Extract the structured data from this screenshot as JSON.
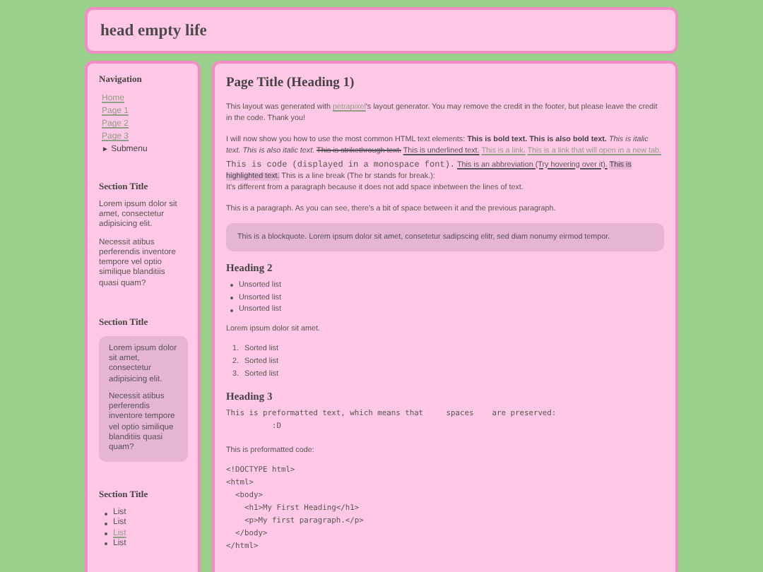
{
  "header": {
    "title": "head empty life"
  },
  "sidebar": {
    "navigation": {
      "title": "Navigation",
      "items": [
        {
          "label": "Home",
          "kind": "link"
        },
        {
          "label": "Page 1",
          "kind": "link"
        },
        {
          "label": "Page 2",
          "kind": "link"
        },
        {
          "label": "Page 3",
          "kind": "link"
        },
        {
          "label": "Submenu",
          "kind": "submenu",
          "expanded": false,
          "marker": "►"
        }
      ]
    },
    "sections": [
      {
        "title": "Section Title",
        "kind": "text",
        "paragraphs": [
          "Lorem ipsum dolor sit amet, consectetur adipisicing elit.",
          "Necessit atibus perferendis inventore tempore vel optio similique blanditiis quasi quam?"
        ]
      },
      {
        "title": "Section Title",
        "kind": "box",
        "paragraphs": [
          "Lorem ipsum dolor sit amet, consectetur adipisicing elit.",
          "Necessit atibus perferendis inventore tempore vel optio similique blanditiis quasi quam?"
        ]
      },
      {
        "title": "Section Title",
        "kind": "list",
        "items": [
          {
            "label": "List",
            "kind": "text"
          },
          {
            "label": "List",
            "kind": "text"
          },
          {
            "label": "List",
            "kind": "link"
          },
          {
            "label": "List",
            "kind": "text"
          }
        ]
      }
    ]
  },
  "main": {
    "blocks": [
      {
        "kind": "h1",
        "text": "Page Title (Heading 1)"
      },
      {
        "kind": "p",
        "segments": [
          {
            "kind": "text",
            "text": "This layout was generated with "
          },
          {
            "kind": "link",
            "text": "petrapixel"
          },
          {
            "kind": "text",
            "text": "'s layout generator. You may remove the credit in the footer, but please leave the credit in the code. Thank you!"
          }
        ]
      },
      {
        "kind": "p",
        "segments": [
          {
            "kind": "text",
            "text": "I will now show you how to use the most common HTML text elements: "
          },
          {
            "kind": "bold",
            "text": "This is bold text."
          },
          {
            "kind": "bold",
            "text": "This is also bold text."
          },
          {
            "kind": "italic",
            "text": "This is italic text."
          },
          {
            "kind": "italic",
            "text": "This is also italic text."
          },
          {
            "kind": "strike",
            "text": "This is strikethrough text."
          },
          {
            "kind": "underline",
            "text": "This is underlined text."
          },
          {
            "kind": "link",
            "text": "This is a link."
          },
          {
            "kind": "link",
            "text": "This is a link that will open in a new tab."
          },
          {
            "kind": "code",
            "text": "This is code (displayed in a monospace font)."
          },
          {
            "kind": "abbr",
            "text": "This is an abbreviation (Try hovering over it)."
          },
          {
            "kind": "highlight",
            "text": "This is highlighted text."
          },
          {
            "kind": "text",
            "text": " This is a line break (The br stands for break.):"
          },
          {
            "kind": "break"
          },
          {
            "kind": "text",
            "text": "It's different from a paragraph because it does not add space inbetween the lines of text."
          }
        ]
      },
      {
        "kind": "p",
        "segments": [
          {
            "kind": "text",
            "text": "This is a paragraph. As you can see, there's a bit of space between it and the previous paragraph."
          }
        ]
      },
      {
        "kind": "blockquote",
        "text": "This is a blockquote. Lorem ipsum dolor sit amet, consetetur sadipscing elitr, sed diam nonumy eirmod tempor."
      },
      {
        "kind": "h2",
        "text": "Heading 2"
      },
      {
        "kind": "ul",
        "items": [
          "Unsorted list",
          "Unsorted list",
          "Unsorted list"
        ]
      },
      {
        "kind": "p",
        "segments": [
          {
            "kind": "text",
            "text": "Lorem ipsum dolor sit amet."
          }
        ]
      },
      {
        "kind": "ol",
        "items": [
          "Sorted list",
          "Sorted list",
          "Sorted list"
        ],
        "numbers": [
          "1.",
          "2.",
          "3."
        ]
      },
      {
        "kind": "h3",
        "text": "Heading 3"
      },
      {
        "kind": "pre",
        "text": "This is preformatted text, which means that     spaces    are preserved:\n          :D"
      },
      {
        "kind": "p",
        "segments": [
          {
            "kind": "text",
            "text": "This is preformatted code:"
          }
        ]
      },
      {
        "kind": "pre",
        "text": "<!DOCTYPE html>\n<html>\n  <body>\n    <h1>My First Heading</h1>\n    <p>My first paragraph.</p>\n  </body>\n</html>"
      }
    ]
  }
}
